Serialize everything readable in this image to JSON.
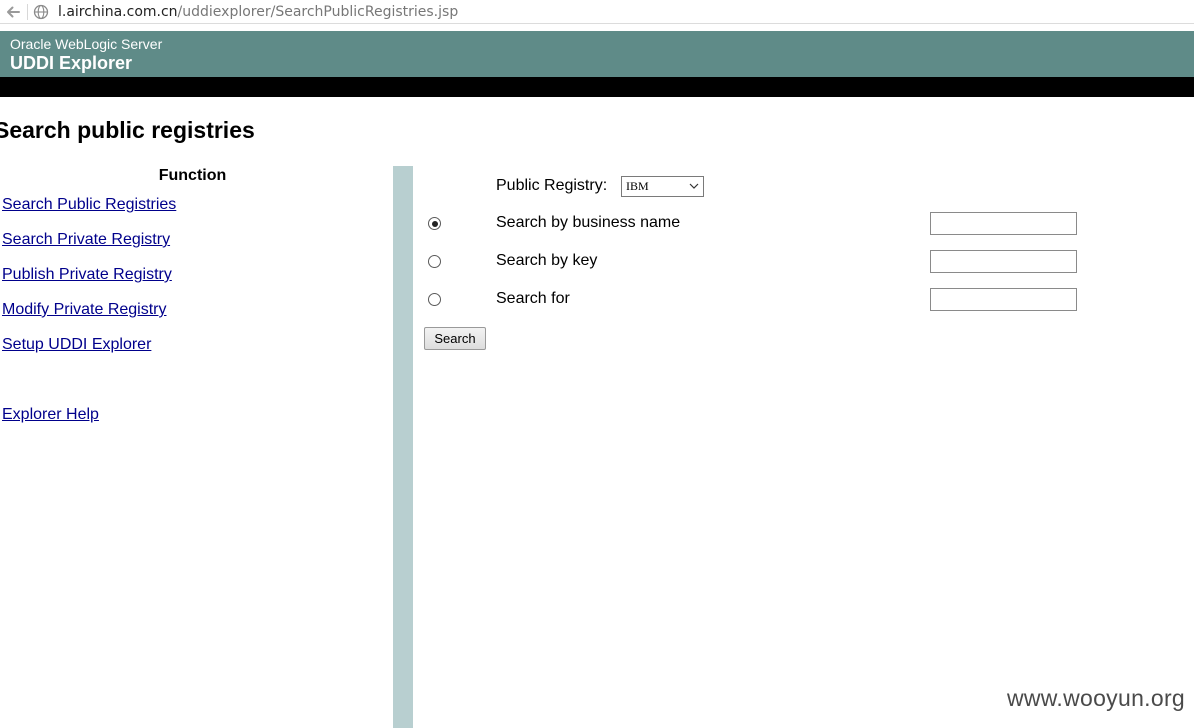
{
  "browser": {
    "url_host": "l.airchina.com.cn",
    "url_path": "/uddiexplorer/SearchPublicRegistries.jsp",
    "icons": {
      "back": "back-arrow-icon",
      "site": "globe-icon"
    }
  },
  "header": {
    "subtitle": "Oracle WebLogic Server",
    "title": "UDDI Explorer"
  },
  "page": {
    "title": "Search public registries"
  },
  "sidebar": {
    "heading": "Function",
    "links": [
      {
        "label": "Search Public Registries"
      },
      {
        "label": "Search Private Registry"
      },
      {
        "label": "Publish Private Registry"
      },
      {
        "label": "Modify Private Registry"
      },
      {
        "label": "Setup UDDI Explorer"
      },
      {
        "label": "Explorer Help"
      }
    ]
  },
  "form": {
    "registry_label": "Public Registry:",
    "registry_value": "IBM",
    "options": [
      {
        "label": "Search by business name",
        "checked": true,
        "value": ""
      },
      {
        "label": "Search by key",
        "checked": false,
        "value": ""
      },
      {
        "label": "Search for",
        "checked": false,
        "value": ""
      }
    ],
    "search_button": "Search"
  },
  "watermark": "www.wooyun.org",
  "colors": {
    "header_bg": "#5f8b88",
    "divider": "#b8cfd0",
    "link": "#00008b"
  }
}
